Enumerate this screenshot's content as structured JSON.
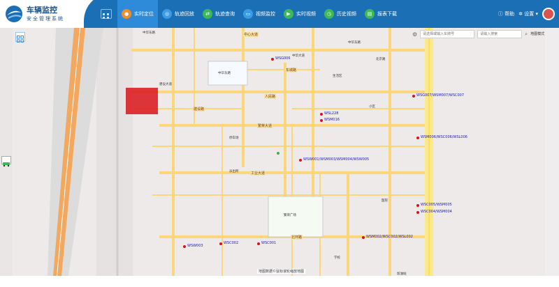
{
  "brand": {
    "title": "车辆监控",
    "subtitle": "安全管理系统"
  },
  "nav": [
    {
      "label": "实时定位",
      "icon": "location-icon",
      "color": "#f08c2a",
      "active": true
    },
    {
      "label": "轨迹回放",
      "icon": "track-icon",
      "color": "#3a9be6",
      "active": false
    },
    {
      "label": "轨迹查询",
      "icon": "route-icon",
      "color": "#3cba55",
      "active": false
    },
    {
      "label": "视频监控",
      "icon": "video-icon",
      "color": "#3a9be6",
      "active": false
    },
    {
      "label": "实时视频",
      "icon": "play-icon",
      "color": "#3cba55",
      "active": false
    },
    {
      "label": "历史视频",
      "icon": "history-icon",
      "color": "#3cba55",
      "active": false
    },
    {
      "label": "报表下载",
      "icon": "report-icon",
      "color": "#3cba55",
      "active": false
    }
  ],
  "header_right": {
    "help": "帮助",
    "settings": "设置"
  },
  "search": {
    "placeholder1": "请选择或输入车牌号",
    "placeholder2": "请输入搜索",
    "layer": "地图模式"
  },
  "map_labels": {
    "poi_zhongyou": "中华大道",
    "poi_park1": "中华东路",
    "poi_shengxu": "生活区",
    "poi_jianshe": "建设大道",
    "area_center": "中华东路",
    "area_middle": "繁荣广场",
    "hint": "地图数据©鼠标滚轮缩放地图"
  },
  "vehicles": [
    "WSG006",
    "WSL228",
    "WSM016",
    "WSG007/WSM007/WSC007",
    "WSM006/WSC006/WSL006",
    "WSW001/WSM003/WSM004/WSW005",
    "WSC005/WSM005",
    "WSC004/WSM004",
    "WSM002/WSC002/WSL002",
    "WSC002",
    "WSC001",
    "WSW003"
  ],
  "roads": [
    "中心大道",
    "东城路",
    "建设路",
    "繁荣大道",
    "工业大道",
    "北环路",
    "人民路"
  ],
  "pois": [
    "中华东路",
    "北京路",
    "小区",
    "停车场",
    "派出所",
    "医院",
    "学校",
    "加油站"
  ]
}
